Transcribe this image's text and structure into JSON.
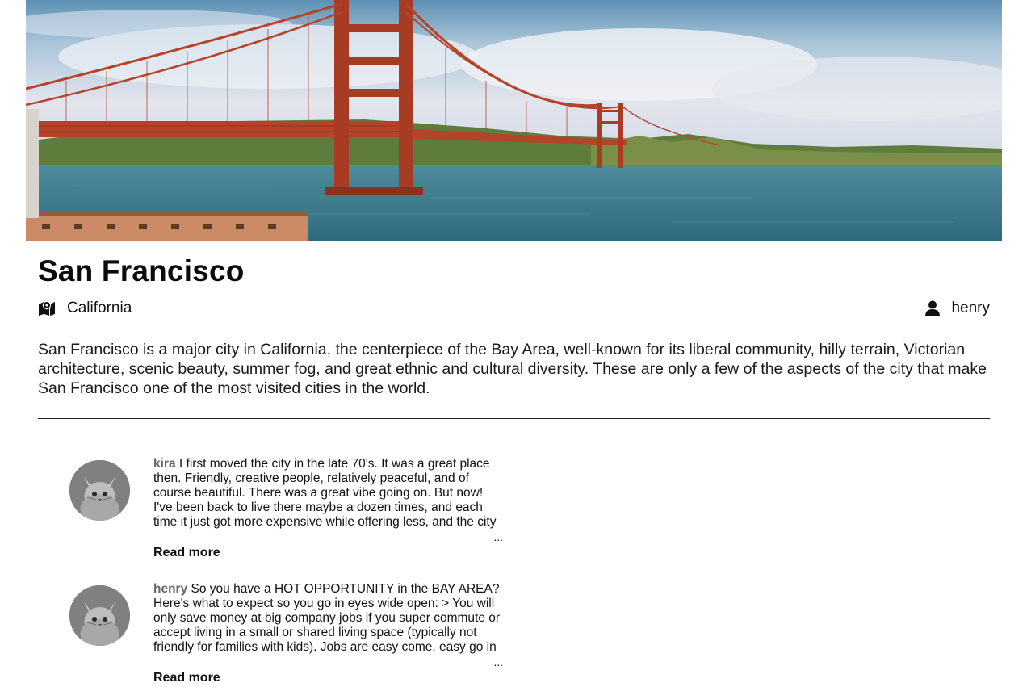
{
  "city": {
    "name": "San Francisco",
    "region": "California",
    "author": "henry",
    "description": "San Francisco is a major city in California, the centerpiece of the Bay Area, well-known for its liberal community, hilly terrain, Victorian architecture, scenic beauty, summer fog, and great ethnic and cultural diversity. These are only a few of the aspects of the city that make San Francisco one of the most visited cities in the world."
  },
  "icons": {
    "region": "map-icon",
    "author": "user-icon"
  },
  "comments": [
    {
      "author": "kira",
      "text": "I first moved the city in the late 70's. It was a great place then. Friendly, creative people, relatively peaceful, and of course beautiful. There was a great vibe going on. But now! I've been back to live there maybe a dozen times, and each time it just got more expensive while offering less, and the city I",
      "ellipsis": "...",
      "read_more": "Read more"
    },
    {
      "author": "henry",
      "text": "So you have a HOT OPPORTUNITY in the BAY AREA? Here's what to expect so you go in eyes wide open: > You will only save money at big company jobs if you super commute or accept living in a small or shared living space (typically not friendly for families with kids). Jobs are easy come, easy go in",
      "ellipsis": "...",
      "read_more": "Read more"
    }
  ],
  "colors": {
    "bridge": "#b5432a",
    "water": "#3f7d8e",
    "sky": "#b9d2e4",
    "hills": "#5e7d3c"
  }
}
